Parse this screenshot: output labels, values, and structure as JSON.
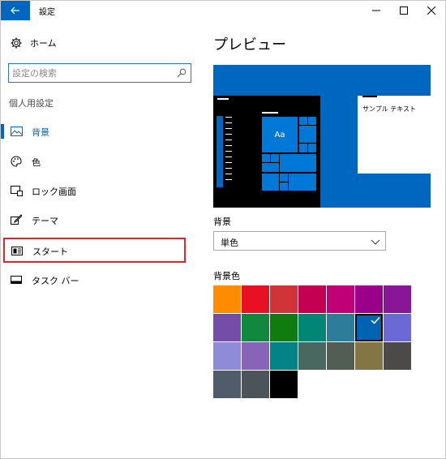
{
  "window": {
    "title": "設定",
    "back_icon": "back-arrow-icon",
    "controls": [
      "minimize-icon",
      "maximize-icon",
      "close-icon"
    ]
  },
  "sidebar": {
    "home_label": "ホーム",
    "search_placeholder": "設定の検索",
    "section_label": "個人用設定",
    "items": [
      {
        "label": "背景",
        "icon": "picture-icon",
        "active": true
      },
      {
        "label": "色",
        "icon": "palette-icon",
        "active": false
      },
      {
        "label": "ロック画面",
        "icon": "lock-screen-icon",
        "active": false
      },
      {
        "label": "テーマ",
        "icon": "theme-brush-icon",
        "active": false
      },
      {
        "label": "スタート",
        "icon": "start-icon",
        "active": false,
        "highlighted": true
      },
      {
        "label": "タスク バー",
        "icon": "taskbar-icon",
        "active": false
      }
    ]
  },
  "main": {
    "title": "プレビュー",
    "preview": {
      "tile_text": "Aa",
      "sample_text": "サンプル テキスト"
    },
    "background_label": "背景",
    "background_value": "単色",
    "color_label": "背景色",
    "colors": [
      "#ff8c00",
      "#e81123",
      "#d13438",
      "#c30052",
      "#bf0077",
      "#9a0089",
      "#881798",
      "#744da9",
      "#10893e",
      "#107c10",
      "#018574",
      "#2d7d9a",
      "#0063b1",
      "#6b69d6",
      "#8e8cd8",
      "#8764b8",
      "#038387",
      "#486860",
      "#525e54",
      "#847545",
      "#4c4a48",
      "#515c6b",
      "#4a5459",
      "#000000"
    ],
    "selected_color": "#0063b1",
    "accent": "#0067c0"
  }
}
